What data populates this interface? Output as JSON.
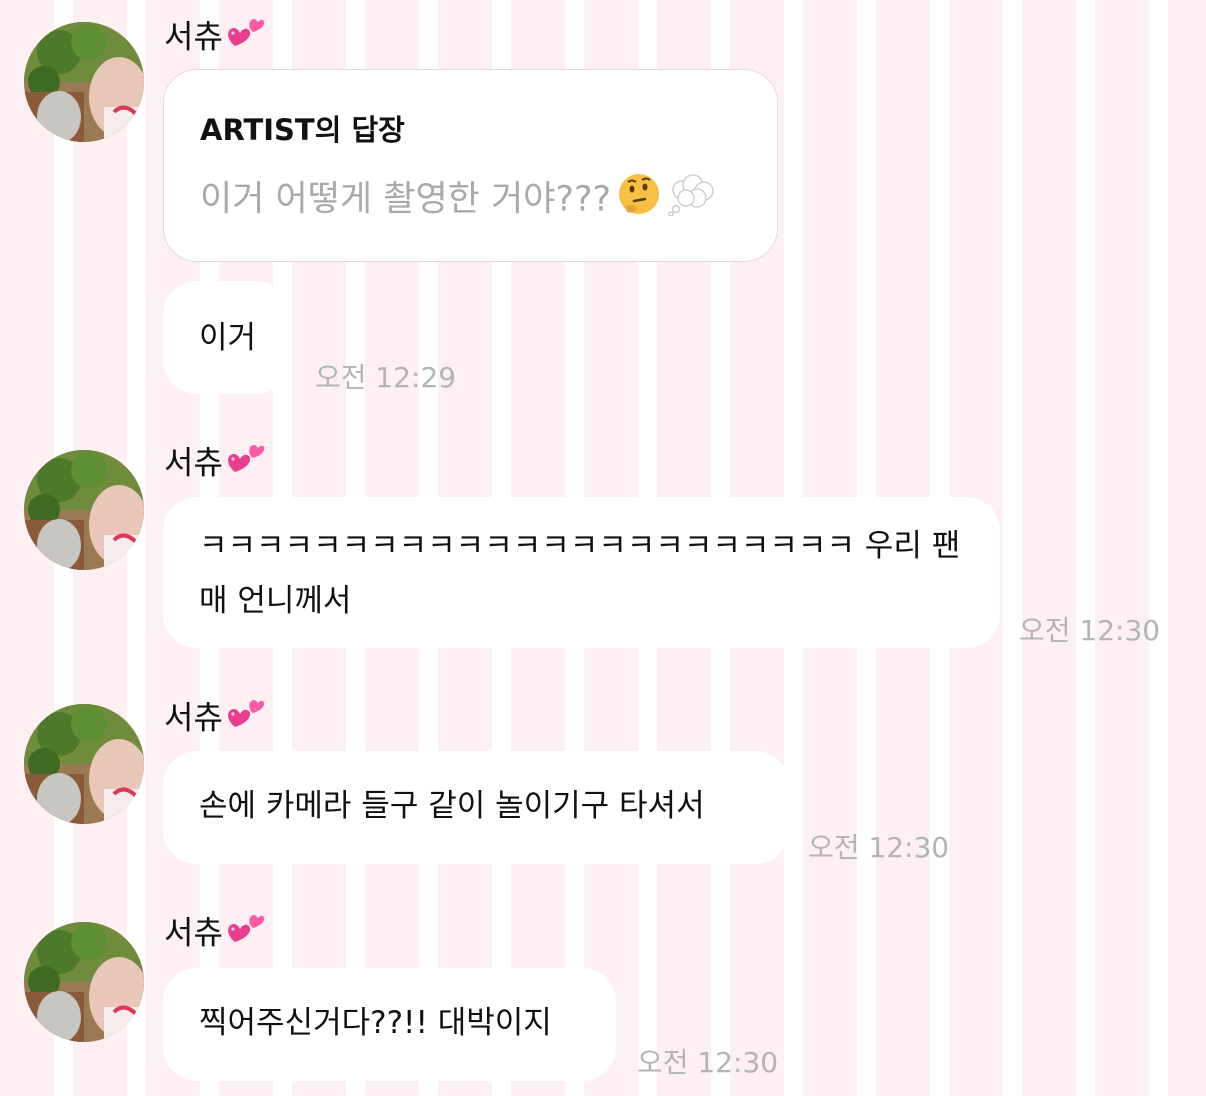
{
  "chat": {
    "sender_name": "서츄",
    "heart_icon": "two-hearts-icon",
    "reply_block": {
      "title": "ARTIST의 답장",
      "text": "이거 어떻게 촬영한 거야???",
      "emojis": [
        "thinking-face-icon",
        "thought-balloon-icon"
      ]
    },
    "messages": [
      {
        "text": "이거",
        "time": "오전 12:29"
      },
      {
        "sender": "서츄",
        "text_line1": "ㅋㅋㅋㅋㅋㅋㅋㅋㅋㅋㅋㅋㅋㅋㅋㅋㅋㅋㅋㅋㅋㅋㅋ 우리 팬",
        "text_line2": "매 언니께서",
        "time": "오전 12:30"
      },
      {
        "sender": "서츄",
        "text": "손에 카메라 들구 같이 놀이기구 타셔서",
        "time": "오전 12:30"
      },
      {
        "sender": "서츄",
        "text": "찍어주신거다??!! 대박이지",
        "time": "오전 12:30"
      }
    ]
  }
}
